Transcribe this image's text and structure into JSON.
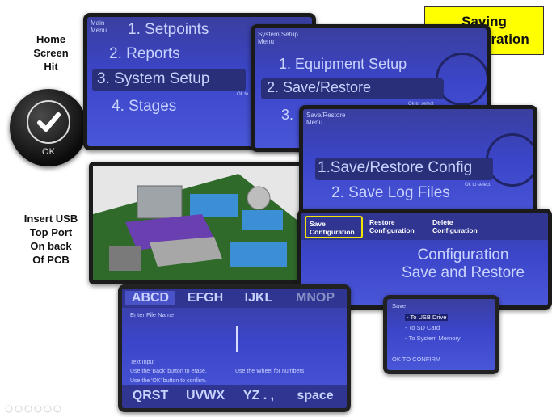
{
  "title_box": {
    "line1": "Saving",
    "line2": "Configuration"
  },
  "left_labels": {
    "home": [
      "Home",
      "Screen",
      "Hit"
    ],
    "ok_button": "OK",
    "usb": [
      "Insert USB",
      "Top Port",
      "On back",
      "Of PCB"
    ]
  },
  "screen_main": {
    "header": [
      "Main",
      "Menu"
    ],
    "items": [
      "1. Setpoints",
      "2. Reports",
      "3. System Setup",
      "4. Stages"
    ],
    "selected_index": 2,
    "hint": "Ok to"
  },
  "screen_system": {
    "header": [
      "System Setup",
      "Menu"
    ],
    "items": [
      "1. Equipment Setup",
      "2. Save/Restore",
      "3."
    ],
    "selected_index": 1,
    "hint": "Ok to select"
  },
  "screen_save_restore": {
    "header": [
      "Save/Restore",
      "Menu"
    ],
    "items": [
      "1.Save/Restore Config",
      "2. Save Log Files"
    ],
    "selected_index": 0,
    "hint": "Ok to select."
  },
  "screen_config": {
    "tabs": [
      {
        "line1": "Save",
        "line2": "Configuration",
        "highlighted": true
      },
      {
        "line1": "Restore",
        "line2": "Configuration",
        "highlighted": false
      },
      {
        "line1": "Delete",
        "line2": "Configuration",
        "highlighted": false
      }
    ],
    "title1": "Configuration",
    "title2": "Save and Restore"
  },
  "screen_filename": {
    "top_keys": [
      "ABCD",
      "EFGH",
      "IJKL",
      "MNOP"
    ],
    "bottom_keys": [
      "QRST",
      "UVWX",
      "YZ . ,",
      "space"
    ],
    "label": "Enter File Name",
    "help_title": "Text Input",
    "help_back": "Use the 'Back' button to erase.",
    "help_wheel": "Use the Wheel for numbers",
    "help_ok": "Use the 'OK' button to confirm."
  },
  "screen_save_to": {
    "title": "Save",
    "options": [
      "- To USB Drive",
      "- To SD Card",
      "- To System Memory"
    ],
    "selected_index": 0,
    "confirm": "OK TO CONFIRM"
  },
  "colors": {
    "title_box_bg": "#ffff00",
    "lcd_blue": "#3b45c9",
    "highlight_yellow": "#f2e600"
  }
}
